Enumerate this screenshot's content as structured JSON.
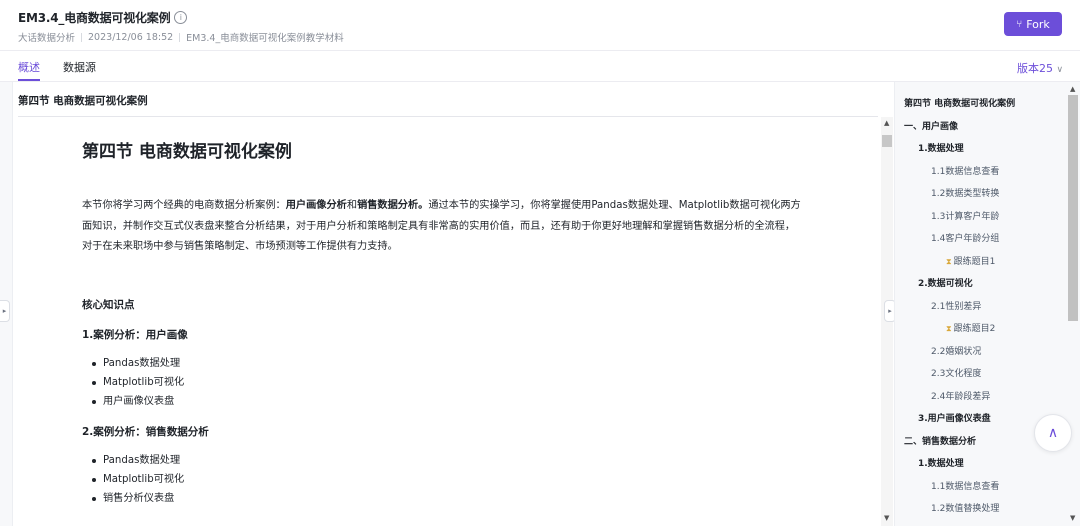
{
  "header": {
    "title": "EM3.4_电商数据可视化案例",
    "meta": [
      "大话数据分析",
      "2023/12/06 18:52",
      "EM3.4_电商数据可视化案例教学材料"
    ],
    "fork_label": "Fork"
  },
  "tabs": [
    {
      "label": "概述",
      "active": true
    },
    {
      "label": "数据源",
      "active": false
    }
  ],
  "version_label": "版本25",
  "content": {
    "section_title": "第四节 电商数据可视化案例",
    "doc_title": "第四节 电商数据可视化案例",
    "intro_prefix": "本节你将学习两个经典的电商数据分析案例：",
    "intro_bold1": "用户画像分析",
    "intro_and": "和",
    "intro_bold2": "销售数据分析。",
    "intro_rest": "通过本节的实操学习，你将掌握使用Pandas数据处理、Matplotlib数据可视化两方面知识，并制作交互式仪表盘来整合分析结果，对于用户分析和策略制定具有非常高的实用价值，而且，还有助于你更好地理解和掌握销售数据分析的全流程，对于在未来职场中参与销售策略制定、市场预测等工作提供有力支持。",
    "core_heading": "核心知识点",
    "case1_heading": "1.案例分析：用户画像",
    "case1_items": [
      "Pandas数据处理",
      "Matplotlib可视化",
      "用户画像仪表盘"
    ],
    "case2_heading": "2.案例分析：销售数据分析",
    "case2_items": [
      "Pandas数据处理",
      "Matplotlib可视化",
      "销售分析仪表盘"
    ]
  },
  "toc": [
    {
      "label": "第四节 电商数据可视化案例",
      "level": 0,
      "bold": true
    },
    {
      "label": "一、用户画像",
      "level": 0,
      "bold": true
    },
    {
      "label": "1.数据处理",
      "level": 1,
      "bold": true
    },
    {
      "label": "1.1数据信息查看",
      "level": 2,
      "bold": false
    },
    {
      "label": "1.2数据类型转换",
      "level": 2,
      "bold": false
    },
    {
      "label": "1.3计算客户年龄",
      "level": 2,
      "bold": false
    },
    {
      "label": "1.4客户年龄分组",
      "level": 2,
      "bold": false
    },
    {
      "label": "跟练题目1",
      "level": 3,
      "bold": false
    },
    {
      "label": "2.数据可视化",
      "level": 1,
      "bold": true
    },
    {
      "label": "2.1性别差异",
      "level": 2,
      "bold": false
    },
    {
      "label": "跟练题目2",
      "level": 3,
      "bold": false
    },
    {
      "label": "2.2婚姻状况",
      "level": 2,
      "bold": false
    },
    {
      "label": "2.3文化程度",
      "level": 2,
      "bold": false
    },
    {
      "label": "2.4年龄段差异",
      "level": 2,
      "bold": false
    },
    {
      "label": "3.用户画像仪表盘",
      "level": 1,
      "bold": true
    },
    {
      "label": "二、销售数据分析",
      "level": 0,
      "bold": true
    },
    {
      "label": "1.数据处理",
      "level": 1,
      "bold": true
    },
    {
      "label": "1.1数据信息查看",
      "level": 2,
      "bold": false
    },
    {
      "label": "1.2数值替换处理",
      "level": 2,
      "bold": false
    }
  ],
  "colors": {
    "accent": "#6c4ed9",
    "exercise_icon": "#d9a83a"
  },
  "icons": {
    "info": "info-icon",
    "fork": "fork-icon",
    "version": "chevron-down-icon",
    "back_to_top": "arrow-up-icon",
    "exercise": "hourglass-icon"
  }
}
